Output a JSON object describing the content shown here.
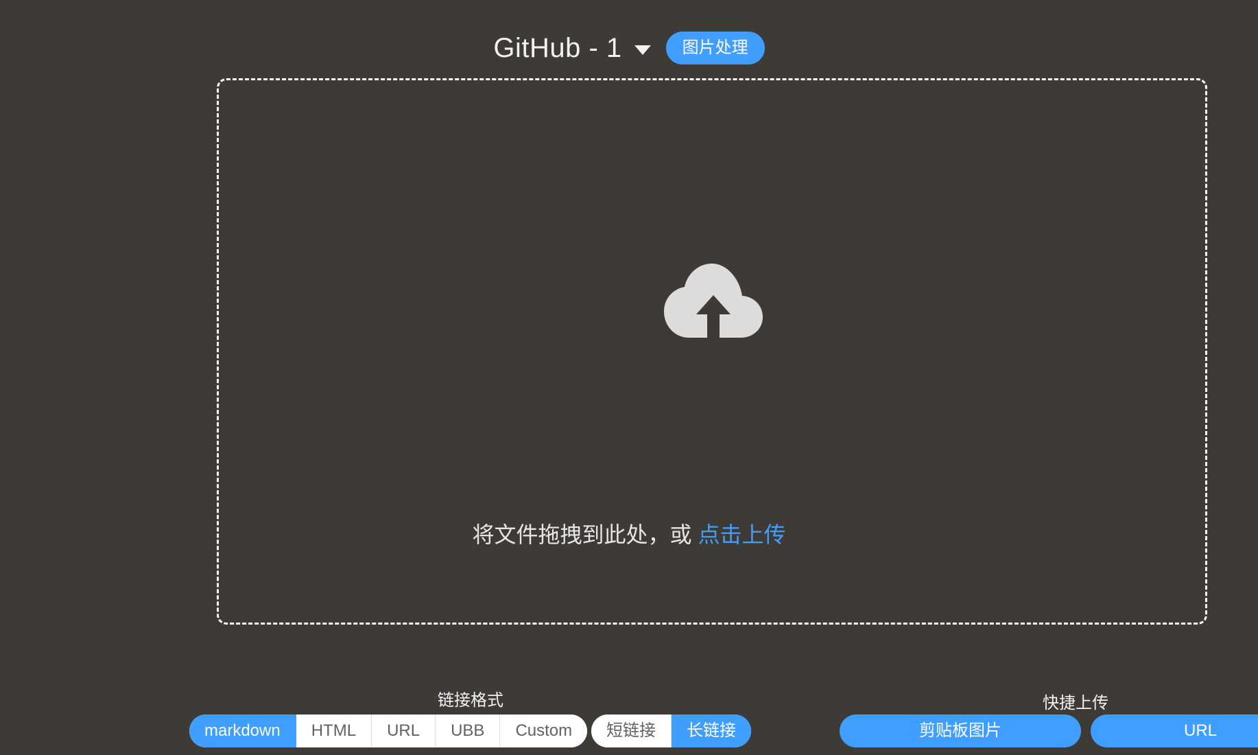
{
  "header": {
    "picbed_name": "GitHub - 1",
    "process_button": "图片处理"
  },
  "dropzone": {
    "text": "将文件拖拽到此处，或",
    "link": "点击上传"
  },
  "link_format": {
    "title": "链接格式",
    "options": [
      "markdown",
      "HTML",
      "URL",
      "UBB",
      "Custom"
    ],
    "selected": "markdown"
  },
  "link_length": {
    "options": [
      "短链接",
      "长链接"
    ],
    "selected": "长链接"
  },
  "quick_upload": {
    "title": "快捷上传",
    "clipboard_button": "剪贴板图片",
    "url_button": "URL"
  },
  "colors": {
    "accent": "#409eff",
    "background": "#3e3b37",
    "icon": "#dddcdb"
  },
  "icons": {
    "upload": "cloud-upload-icon",
    "dropdown": "caret-down-icon"
  }
}
